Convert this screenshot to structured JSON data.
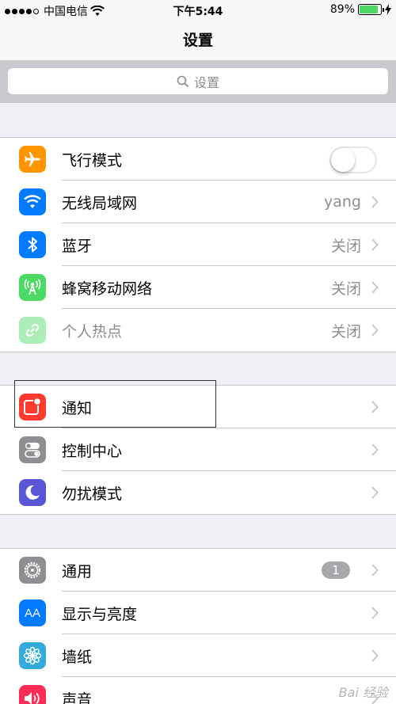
{
  "status_bar": {
    "carrier": "中国电信",
    "time": "下午5:44",
    "battery_percent": "89%",
    "battery_level": 0.89,
    "signal_bars_filled": 4
  },
  "nav": {
    "title": "设置"
  },
  "search": {
    "placeholder": "设置"
  },
  "groups": [
    {
      "rows": [
        {
          "label": "飞行模式",
          "icon": "airplane-icon",
          "color": "#ff9500",
          "toggle": false
        },
        {
          "label": "无线局域网",
          "icon": "wifi-icon",
          "color": "#007aff",
          "value": "yang"
        },
        {
          "label": "蓝牙",
          "icon": "bluetooth-icon",
          "color": "#007aff",
          "value": "关闭"
        },
        {
          "label": "蜂窝移动网络",
          "icon": "cellular-icon",
          "color": "#4cd964",
          "value": "关闭"
        },
        {
          "label": "个人热点",
          "icon": "hotspot-icon",
          "color": "#4cd964",
          "value": "关闭",
          "disabled": true
        }
      ]
    },
    {
      "rows": [
        {
          "label": "通知",
          "icon": "notifications-icon",
          "color": "#ff3b30"
        },
        {
          "label": "控制中心",
          "icon": "control-center-icon",
          "color": "#8e8e93"
        },
        {
          "label": "勿扰模式",
          "icon": "do-not-disturb-icon",
          "color": "#5856d6"
        }
      ]
    },
    {
      "rows": [
        {
          "label": "通用",
          "icon": "gear-icon",
          "color": "#8e8e93",
          "badge": "1"
        },
        {
          "label": "显示与亮度",
          "icon": "display-brightness-icon",
          "color": "#007aff",
          "icon_text": "AA"
        },
        {
          "label": "墙纸",
          "icon": "wallpaper-icon",
          "color": "#34aadc"
        },
        {
          "label": "声音",
          "icon": "sound-icon",
          "color": "#ff2d55"
        }
      ]
    }
  ],
  "watermark": "Bai 经验"
}
